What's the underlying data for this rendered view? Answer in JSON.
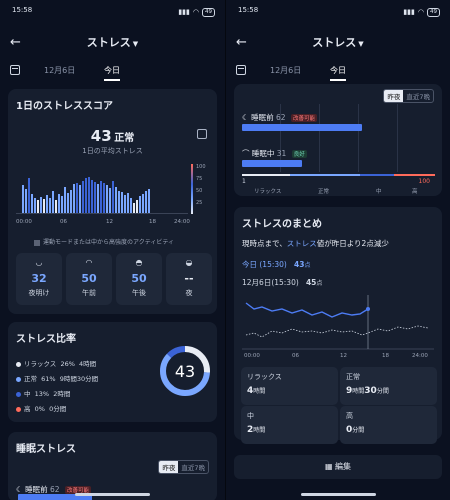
{
  "status": {
    "time": "15:58",
    "battery": "49"
  },
  "nav": {
    "back_icon": "arrow-left-icon",
    "title": "ストレス",
    "tab_prev": "12月6日",
    "tab_today": "今日"
  },
  "daily": {
    "title": "1日のストレススコア",
    "score": "43",
    "level": "正常",
    "subtitle": "1日の平均ストレス",
    "ticks_x": [
      "00:00",
      "06",
      "12",
      "18",
      "24:00"
    ],
    "ticks_y": [
      "100",
      "75",
      "50",
      "25"
    ],
    "legend": "運動モードまたは中から高強度のアクティビティ",
    "bar_values": [
      55,
      48,
      70,
      38,
      30,
      25,
      32,
      28,
      35,
      30,
      44,
      26,
      38,
      34,
      52,
      40,
      46,
      58,
      60,
      55,
      64,
      70,
      72,
      66,
      62,
      58,
      64,
      60,
      55,
      50,
      64,
      52,
      44,
      42,
      36,
      40,
      30,
      20,
      26,
      34,
      38,
      44,
      48
    ]
  },
  "tiles": [
    {
      "icon": "sunrise-icon",
      "value": "32",
      "label": "夜明け"
    },
    {
      "icon": "morning-icon",
      "value": "50",
      "label": "午前"
    },
    {
      "icon": "afternoon-icon",
      "value": "50",
      "label": "午後"
    },
    {
      "icon": "sunset-icon",
      "value": "--",
      "label": "夜"
    }
  ],
  "ratio": {
    "title": "ストレス比率",
    "score": "43",
    "items": [
      {
        "name": "リラックス",
        "pct": "26%",
        "time": "4時間",
        "color": "#e8ecf4",
        "fraction": 0.26
      },
      {
        "name": "正常",
        "pct": "61%",
        "time": "9時間30分間",
        "color": "#7aa7ff",
        "fraction": 0.61
      },
      {
        "name": "中",
        "pct": "13%",
        "time": "2時間",
        "color": "#3b63d6",
        "fraction": 0.13
      },
      {
        "name": "高",
        "pct": "0%",
        "time": "0分間",
        "color": "#ff6b5b",
        "fraction": 0.0
      }
    ]
  },
  "sleep": {
    "title": "睡眠ストレス",
    "toggle_a": "昨夜",
    "toggle_b": "直近7晩",
    "pre_label": "睡眠前",
    "pre_value": "62",
    "pre_badge": "改善可能",
    "pre_fraction": 0.62,
    "during_label": "睡眠中",
    "during_value": "31",
    "during_badge": "良好",
    "during_fraction": 0.31,
    "scale_min": "1",
    "scale_max": "100",
    "scale_labels": [
      "リラックス",
      "正常",
      "中",
      "高"
    ]
  },
  "summary": {
    "title": "ストレスのまとめ",
    "text_a": "現時点まで、",
    "text_link": "ストレス",
    "text_b": "値が昨日より2点減少",
    "today_label": "今日 (15:30)",
    "today_value": "43",
    "today_unit": "点",
    "prev_label": "12月6日(15:30)",
    "prev_value": "45",
    "prev_unit": "点",
    "ticks_x": [
      "00:00",
      "06",
      "12",
      "18",
      "24:00"
    ],
    "stats": [
      {
        "label": "リラックス",
        "n1": "4",
        "u1": "時間",
        "n2": "",
        "u2": ""
      },
      {
        "label": "正常",
        "n1": "9",
        "u1": "時間",
        "n2": "30",
        "u2": "分間"
      },
      {
        "label": "中",
        "n1": "2",
        "u1": "時間",
        "n2": "",
        "u2": ""
      },
      {
        "label": "高",
        "n1": "0",
        "u1": "分間",
        "n2": "",
        "u2": ""
      }
    ]
  },
  "edit": {
    "label": "編集",
    "icon": "edit-icon"
  }
}
